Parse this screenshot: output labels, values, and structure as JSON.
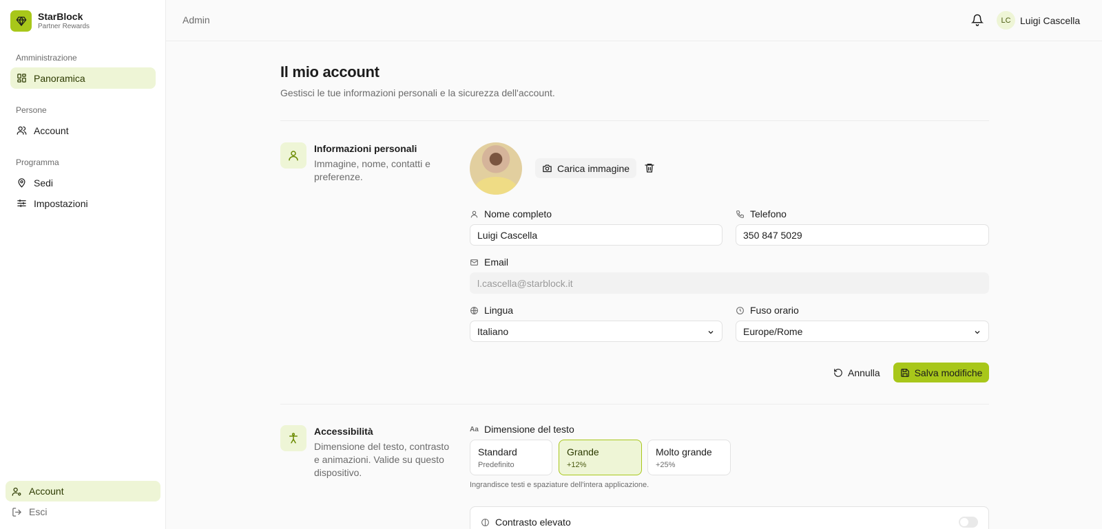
{
  "brand": {
    "name": "StarBlock",
    "subtitle": "Partner Rewards",
    "accent": "#a8c71a"
  },
  "sidebar": {
    "sections": [
      {
        "label": "Amministrazione"
      },
      {
        "label": "Persone"
      },
      {
        "label": "Programma"
      }
    ],
    "items": [
      {
        "label": "Panoramica",
        "icon": "dashboard-icon",
        "active": true
      },
      {
        "label": "Account",
        "icon": "users-icon"
      },
      {
        "label": "Sedi",
        "icon": "map-pin-icon"
      },
      {
        "label": "Impostazioni",
        "icon": "sliders-icon"
      }
    ],
    "bottom": [
      {
        "label": "Account",
        "icon": "user-cog-icon",
        "active": true
      },
      {
        "label": "Esci",
        "icon": "logout-icon"
      }
    ]
  },
  "header": {
    "breadcrumb": "Admin",
    "user": {
      "initials": "LC",
      "name": "Luigi Cascella"
    }
  },
  "page": {
    "title": "Il mio account",
    "subtitle": "Gestisci le tue informazioni personali e la sicurezza dell'account."
  },
  "personal": {
    "title": "Informazioni personali",
    "description": "Immagine, nome, contatti e preferenze.",
    "upload_label": "Carica immagine",
    "fields": {
      "fullname": {
        "label": "Nome completo",
        "value": "Luigi Cascella"
      },
      "phone": {
        "label": "Telefono",
        "value": "350 847 5029"
      },
      "email": {
        "label": "Email",
        "value": "l.cascella@starblock.it"
      },
      "language": {
        "label": "Lingua",
        "value": "Italiano"
      },
      "timezone": {
        "label": "Fuso orario",
        "value": "Europe/Rome"
      }
    },
    "cancel_label": "Annulla",
    "save_label": "Salva modifiche"
  },
  "accessibility": {
    "title": "Accessibilità",
    "description": "Dimensione del testo, contrasto e animazioni. Valide su questo dispositivo.",
    "text_size_label": "Dimensione del testo",
    "text_size_options": [
      {
        "title": "Standard",
        "sub": "Predefinito"
      },
      {
        "title": "Grande",
        "sub": "+12%",
        "selected": true
      },
      {
        "title": "Molto grande",
        "sub": "+25%"
      }
    ],
    "text_size_hint": "Ingrandisce testi e spaziature dell'intera applicazione.",
    "contrast_label": "Contrasto elevato",
    "contrast_enabled": false
  }
}
